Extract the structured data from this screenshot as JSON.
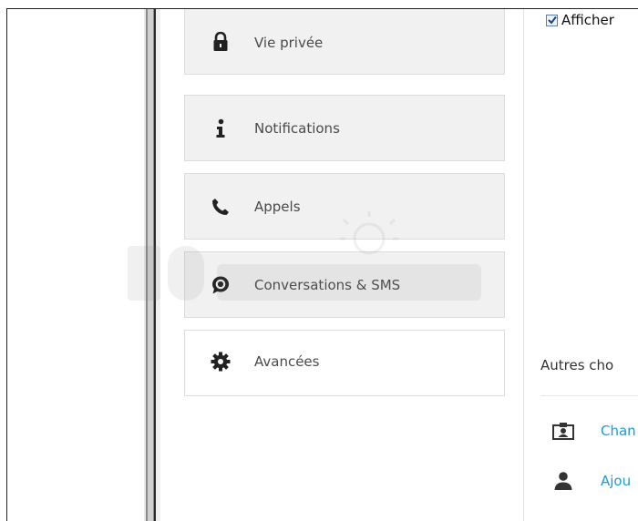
{
  "nav": {
    "items": [
      {
        "label": "Vie privée",
        "icon": "lock-icon"
      },
      {
        "label": "Notifications",
        "icon": "info-icon"
      },
      {
        "label": "Appels",
        "icon": "phone-icon"
      },
      {
        "label": "Conversations & SMS",
        "icon": "chat-bubble-icon"
      },
      {
        "label": "Avancées",
        "icon": "gear-icon"
      }
    ],
    "active_index": 4
  },
  "content": {
    "checkbox_label": "Afficher",
    "checkbox_checked": true,
    "other_title": "Autres cho",
    "links": [
      {
        "label": "Chan",
        "icon": "contact-card-icon"
      },
      {
        "label": "Ajou",
        "icon": "user-icon"
      }
    ]
  },
  "colors": {
    "link": "#1a9bd7",
    "nav_bg": "#f1f1f1",
    "active_bg": "#ffffff",
    "border": "#dcdcdc"
  }
}
